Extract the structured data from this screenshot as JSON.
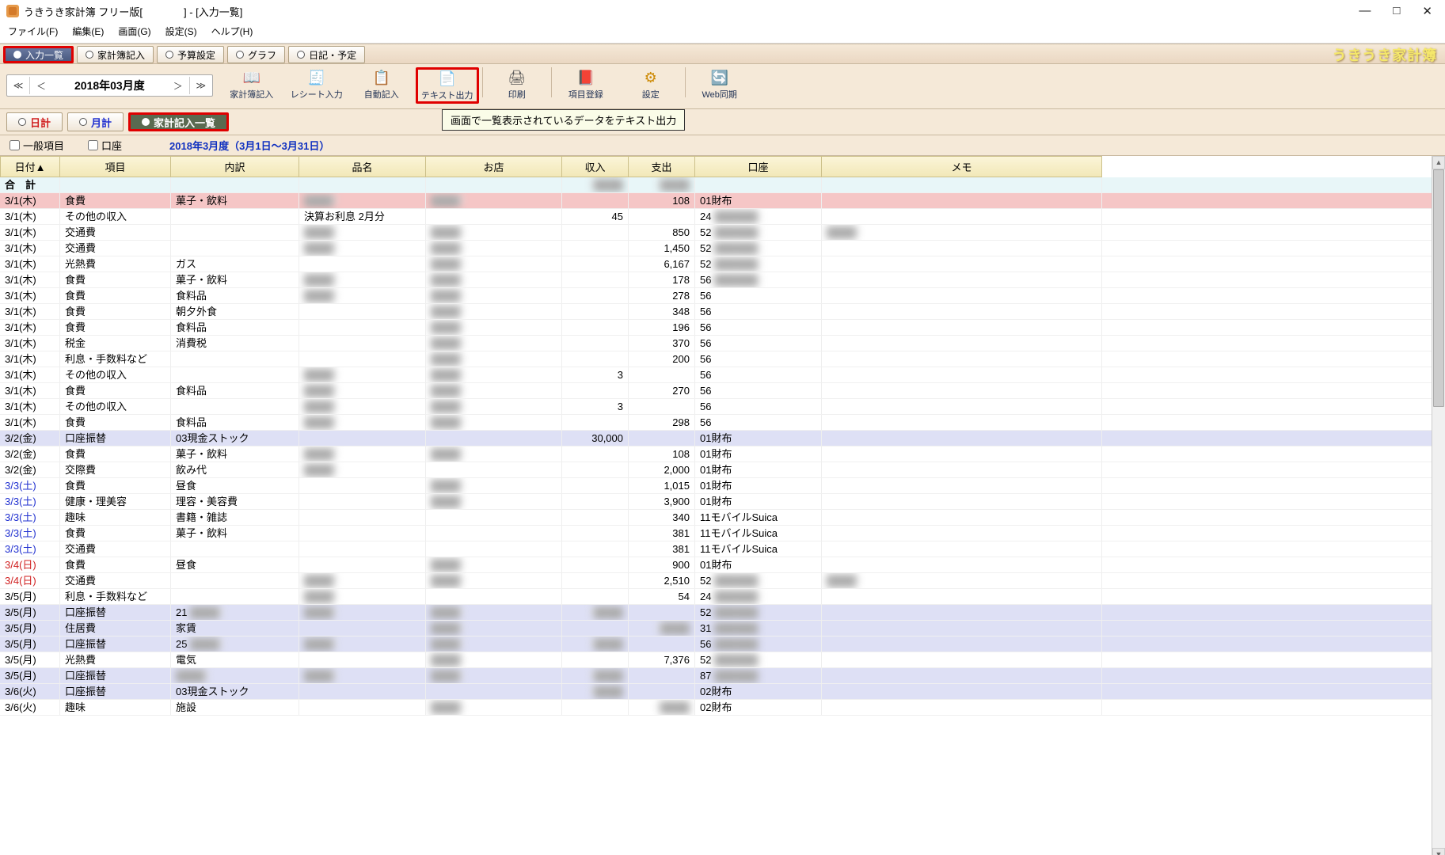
{
  "title": "うきうき家計簿 フリー版[　　　　] - [入力一覧]",
  "win": {
    "min": "—",
    "max": "□",
    "close": "✕"
  },
  "menu": [
    "ファイル(F)",
    "編集(E)",
    "画面(G)",
    "設定(S)",
    "ヘルプ(H)"
  ],
  "brand": "うきうき家計簿",
  "maintabs": [
    {
      "label": "入力一覧",
      "selected": true,
      "hl": true
    },
    {
      "label": "家計簿記入",
      "selected": false
    },
    {
      "label": "予算設定",
      "selected": false
    },
    {
      "label": "グラフ",
      "selected": false
    },
    {
      "label": "日記・予定",
      "selected": false
    }
  ],
  "month_nav": {
    "dprev": "≪",
    "prev": "＜",
    "label": "2018年03月度",
    "next": "＞",
    "dnext": "≫"
  },
  "tools": [
    {
      "label": "家計簿記入",
      "icon": "📖",
      "cls": "book"
    },
    {
      "label": "レシート入力",
      "icon": "🧾",
      "cls": "receipt"
    },
    {
      "label": "自動記入",
      "icon": "📋",
      "cls": "auto"
    },
    {
      "label": "テキスト出力",
      "icon": "📄",
      "cls": "text",
      "hl": true
    },
    {
      "label": "印刷",
      "icon": "🖨",
      "cls": "print",
      "sepBefore": true
    },
    {
      "label": "項目登録",
      "icon": "📕",
      "cls": "reg",
      "sepBefore": true
    },
    {
      "label": "設定",
      "icon": "⚙",
      "cls": "set"
    },
    {
      "label": "Web同期",
      "icon": "🔄",
      "cls": "web",
      "sepBefore": true
    }
  ],
  "subtabs": [
    {
      "label": "日計",
      "cls": "red"
    },
    {
      "label": "月計",
      "cls": "blue"
    },
    {
      "label": "家計記入一覧",
      "cls": "selected",
      "selected": true,
      "hl": true
    }
  ],
  "tooltip": "画面で一覧表示されているデータをテキスト出力",
  "filters": {
    "ippan": "一般項目",
    "kouza": "口座",
    "period": "2018年3月度（3月1日～3月31日）"
  },
  "columns": [
    "日付▲",
    "項目",
    "内訳",
    "品名",
    "お店",
    "収入",
    "支出",
    "口座",
    "メモ"
  ],
  "total_label": "合　計",
  "rows": [
    {
      "d": "3/1(木)",
      "item": "食費",
      "sub": "菓子・飲料",
      "name": "",
      "shop": "",
      "in": "",
      "out": "108",
      "acct": "01財布",
      "memo": "",
      "cls": "pink",
      "blur": [
        "name",
        "shop"
      ]
    },
    {
      "d": "3/1(木)",
      "item": "その他の収入",
      "sub": "",
      "name": "決算お利息 2月分",
      "shop": "",
      "in": "45",
      "out": "",
      "acct": "24",
      "memo": "",
      "blur": [
        "acctx"
      ]
    },
    {
      "d": "3/1(木)",
      "item": "交通費",
      "sub": "",
      "name": "",
      "shop": "",
      "in": "",
      "out": "850",
      "acct": "52",
      "memo": "",
      "blur": [
        "name",
        "shop",
        "acctx",
        "memo"
      ]
    },
    {
      "d": "3/1(木)",
      "item": "交通費",
      "sub": "",
      "name": "",
      "shop": "",
      "in": "",
      "out": "1,450",
      "acct": "52",
      "memo": "",
      "blur": [
        "name",
        "shop",
        "acctx"
      ]
    },
    {
      "d": "3/1(木)",
      "item": "光熱費",
      "sub": "ガス",
      "name": "",
      "shop": "",
      "in": "",
      "out": "6,167",
      "acct": "52",
      "memo": "",
      "blur": [
        "shop",
        "acctx"
      ]
    },
    {
      "d": "3/1(木)",
      "item": "食費",
      "sub": "菓子・飲料",
      "name": "",
      "shop": "",
      "in": "",
      "out": "178",
      "acct": "56",
      "memo": "",
      "blur": [
        "name",
        "shop",
        "acctx"
      ]
    },
    {
      "d": "3/1(木)",
      "item": "食費",
      "sub": "食料品",
      "name": "",
      "shop": "",
      "in": "",
      "out": "278",
      "acct": "56",
      "memo": "",
      "blur": [
        "name",
        "shop"
      ]
    },
    {
      "d": "3/1(木)",
      "item": "食費",
      "sub": "朝夕外食",
      "name": "",
      "shop": "",
      "in": "",
      "out": "348",
      "acct": "56",
      "memo": "",
      "blur": [
        "shop"
      ]
    },
    {
      "d": "3/1(木)",
      "item": "食費",
      "sub": "食料品",
      "name": "",
      "shop": "",
      "in": "",
      "out": "196",
      "acct": "56",
      "memo": "",
      "blur": [
        "shop"
      ]
    },
    {
      "d": "3/1(木)",
      "item": "税金",
      "sub": "消費税",
      "name": "",
      "shop": "",
      "in": "",
      "out": "370",
      "acct": "56",
      "memo": "",
      "blur": [
        "shop"
      ]
    },
    {
      "d": "3/1(木)",
      "item": "利息・手数料など",
      "sub": "",
      "name": "",
      "shop": "",
      "in": "",
      "out": "200",
      "acct": "56",
      "memo": "",
      "blur": [
        "shop"
      ]
    },
    {
      "d": "3/1(木)",
      "item": "その他の収入",
      "sub": "",
      "name": "",
      "shop": "",
      "in": "3",
      "out": "",
      "acct": "56",
      "memo": "",
      "blur": [
        "name",
        "shop"
      ]
    },
    {
      "d": "3/1(木)",
      "item": "食費",
      "sub": "食料品",
      "name": "",
      "shop": "",
      "in": "",
      "out": "270",
      "acct": "56",
      "memo": "",
      "blur": [
        "name",
        "shop"
      ]
    },
    {
      "d": "3/1(木)",
      "item": "その他の収入",
      "sub": "",
      "name": "",
      "shop": "",
      "in": "3",
      "out": "",
      "acct": "56",
      "memo": "",
      "blur": [
        "name",
        "shop"
      ]
    },
    {
      "d": "3/1(木)",
      "item": "食費",
      "sub": "食料品",
      "name": "",
      "shop": "",
      "in": "",
      "out": "298",
      "acct": "56",
      "memo": "",
      "blur": [
        "name",
        "shop"
      ]
    },
    {
      "d": "3/2(金)",
      "item": "口座振替",
      "sub": "03現金ストック",
      "name": "",
      "shop": "",
      "in": "30,000",
      "out": "",
      "acct": "01財布",
      "memo": "",
      "cls": "lav"
    },
    {
      "d": "3/2(金)",
      "item": "食費",
      "sub": "菓子・飲料",
      "name": "",
      "shop": "",
      "in": "",
      "out": "108",
      "acct": "01財布",
      "memo": "",
      "blur": [
        "name",
        "shop"
      ]
    },
    {
      "d": "3/2(金)",
      "item": "交際費",
      "sub": "飲み代",
      "name": "",
      "shop": "",
      "in": "",
      "out": "2,000",
      "acct": "01財布",
      "memo": "",
      "blur": [
        "name"
      ]
    },
    {
      "d": "3/3(土)",
      "item": "食費",
      "sub": "昼食",
      "name": "",
      "shop": "",
      "in": "",
      "out": "1,015",
      "acct": "01財布",
      "memo": "",
      "dcls": "sat",
      "blur": [
        "shop"
      ]
    },
    {
      "d": "3/3(土)",
      "item": "健康・理美容",
      "sub": "理容・美容費",
      "name": "",
      "shop": "",
      "in": "",
      "out": "3,900",
      "acct": "01財布",
      "memo": "",
      "dcls": "sat",
      "blur": [
        "shop"
      ]
    },
    {
      "d": "3/3(土)",
      "item": "趣味",
      "sub": "書籍・雑誌",
      "name": "",
      "shop": "",
      "in": "",
      "out": "340",
      "acct": "11モバイルSuica",
      "memo": "",
      "dcls": "sat"
    },
    {
      "d": "3/3(土)",
      "item": "食費",
      "sub": "菓子・飲料",
      "name": "",
      "shop": "",
      "in": "",
      "out": "381",
      "acct": "11モバイルSuica",
      "memo": "",
      "dcls": "sat"
    },
    {
      "d": "3/3(土)",
      "item": "交通費",
      "sub": "",
      "name": "",
      "shop": "",
      "in": "",
      "out": "381",
      "acct": "11モバイルSuica",
      "memo": "",
      "dcls": "sat"
    },
    {
      "d": "3/4(日)",
      "item": "食費",
      "sub": "昼食",
      "name": "",
      "shop": "",
      "in": "",
      "out": "900",
      "acct": "01財布",
      "memo": "",
      "dcls": "sun",
      "blur": [
        "shop"
      ]
    },
    {
      "d": "3/4(日)",
      "item": "交通費",
      "sub": "",
      "name": "",
      "shop": "",
      "in": "",
      "out": "2,510",
      "acct": "52",
      "memo": "",
      "dcls": "sun",
      "blur": [
        "name",
        "shop",
        "acctx",
        "memo"
      ]
    },
    {
      "d": "3/5(月)",
      "item": "利息・手数料など",
      "sub": "",
      "name": "",
      "shop": "",
      "in": "",
      "out": "54",
      "acct": "24",
      "memo": "",
      "blur": [
        "name",
        "acctx"
      ]
    },
    {
      "d": "3/5(月)",
      "item": "口座振替",
      "sub": "21",
      "name": "",
      "shop": "",
      "in": "",
      "out": "",
      "acct": "52",
      "memo": "",
      "cls": "lav",
      "blur": [
        "subx",
        "name",
        "shop",
        "in",
        "acctx"
      ]
    },
    {
      "d": "3/5(月)",
      "item": "住居費",
      "sub": "家賃",
      "name": "",
      "shop": "",
      "in": "",
      "out": "",
      "acct": "31",
      "memo": "",
      "cls": "lav",
      "blur": [
        "shop",
        "out",
        "acctx"
      ]
    },
    {
      "d": "3/5(月)",
      "item": "口座振替",
      "sub": "25",
      "name": "",
      "shop": "",
      "in": "",
      "out": "",
      "acct": "56",
      "memo": "",
      "cls": "lav",
      "blur": [
        "subx",
        "name",
        "shop",
        "in",
        "acctx"
      ]
    },
    {
      "d": "3/5(月)",
      "item": "光熱費",
      "sub": "電気",
      "name": "",
      "shop": "",
      "in": "",
      "out": "7,376",
      "acct": "52",
      "memo": "",
      "blur": [
        "shop",
        "acctx"
      ]
    },
    {
      "d": "3/5(月)",
      "item": "口座振替",
      "sub": "",
      "name": "",
      "shop": "",
      "in": "",
      "out": "",
      "acct": "87",
      "memo": "",
      "cls": "lav",
      "blur": [
        "sub",
        "name",
        "shop",
        "in",
        "acctx"
      ]
    },
    {
      "d": "3/6(火)",
      "item": "口座振替",
      "sub": "03現金ストック",
      "name": "",
      "shop": "",
      "in": "",
      "out": "",
      "acct": "02財布",
      "memo": "",
      "cls": "lav",
      "blur": [
        "in"
      ]
    },
    {
      "d": "3/6(火)",
      "item": "趣味",
      "sub": "施設",
      "name": "",
      "shop": "",
      "in": "",
      "out": "",
      "acct": "02財布",
      "memo": "",
      "blur": [
        "shop",
        "out"
      ]
    }
  ]
}
